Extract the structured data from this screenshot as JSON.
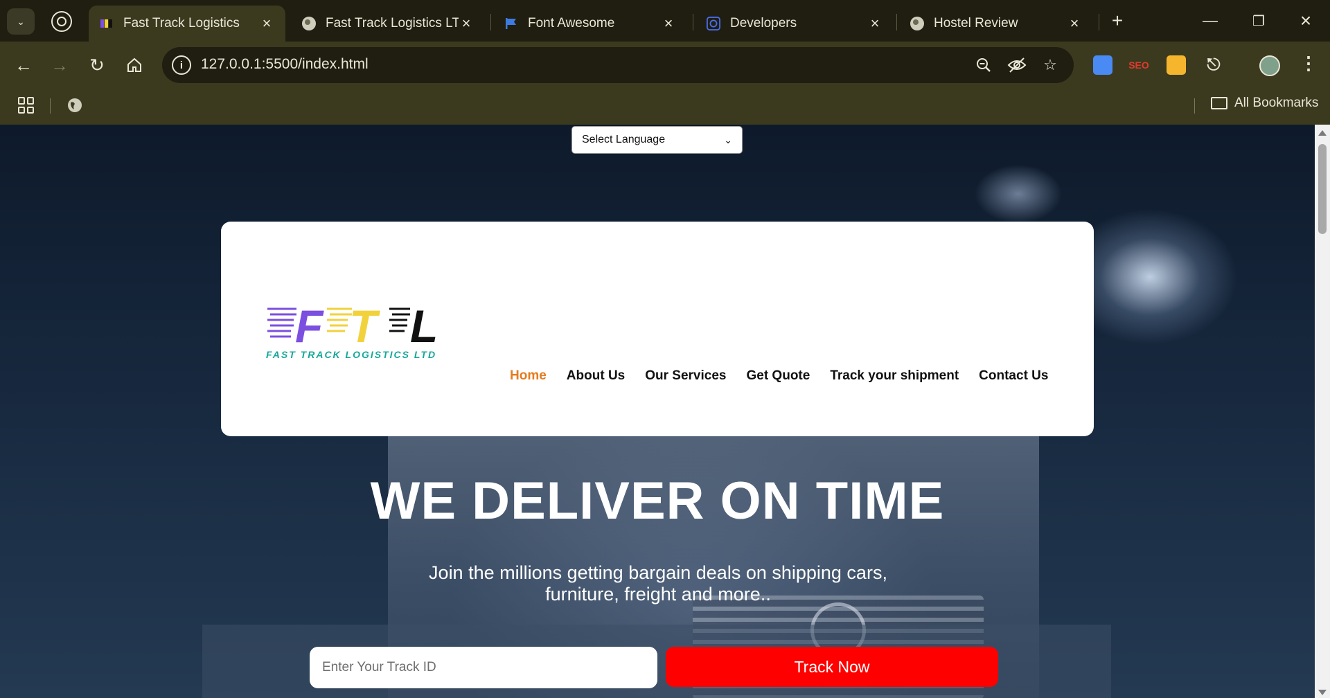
{
  "browser": {
    "tabs": [
      {
        "label": "Fast Track Logistics",
        "active": true,
        "icon": "ftl-favicon"
      },
      {
        "label": "Fast Track Logistics LTD",
        "active": false,
        "icon": "globe-icon"
      },
      {
        "label": "Font Awesome",
        "active": false,
        "icon": "flag-icon"
      },
      {
        "label": "Developers",
        "active": false,
        "icon": "developers-icon"
      },
      {
        "label": "Hostel Review",
        "active": false,
        "icon": "globe-icon"
      }
    ],
    "url": "127.0.0.1:5500/index.html",
    "bookmarks_label": "All Bookmarks",
    "extensions": [
      {
        "name": "docs-extension-icon",
        "color": "#4a8af4"
      },
      {
        "name": "seo-extension-icon",
        "color": "#e03a2f",
        "text": "SEO"
      },
      {
        "name": "puzzle-color-extension-icon",
        "color": "#f5b62e"
      }
    ]
  },
  "page": {
    "language_select": {
      "value": "Select Language"
    },
    "logo": {
      "letters": [
        "F",
        "T",
        "L"
      ],
      "tagline": "FAST TRACK LOGISTICS LTD"
    },
    "nav": [
      {
        "label": "Home",
        "active": true
      },
      {
        "label": "About Us",
        "active": false
      },
      {
        "label": "Our Services",
        "active": false
      },
      {
        "label": "Get Quote",
        "active": false
      },
      {
        "label": "Track your shipment",
        "active": false
      },
      {
        "label": "Contact Us",
        "active": false
      }
    ],
    "hero": {
      "title": "WE DELIVER ON TIME",
      "subtitle_line1": "Join the millions getting bargain deals on shipping cars,",
      "subtitle_line2": "furniture, freight and more.."
    },
    "track": {
      "placeholder": "Enter Your Track ID",
      "button": "Track Now"
    }
  },
  "colors": {
    "chrome_dark": "#1f1e10",
    "chrome": "#3b3a1f",
    "nav_active": "#e57b1e",
    "track_button": "#ff0000",
    "logo_purple": "#7b4fe0",
    "logo_yellow": "#f2d23c",
    "logo_black": "#111111",
    "tagline_teal": "#17a79a"
  }
}
